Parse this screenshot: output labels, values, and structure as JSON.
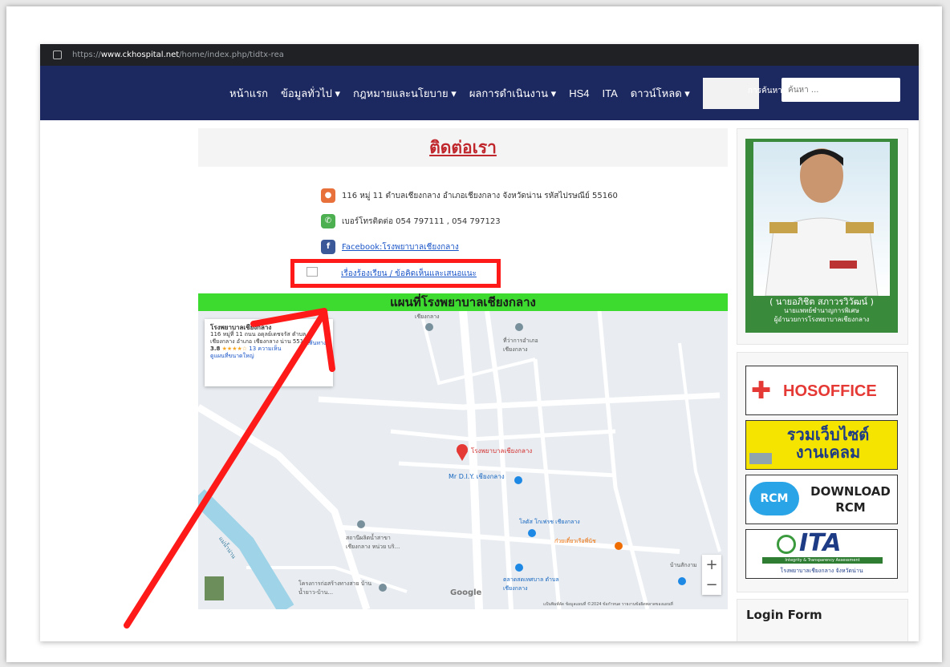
{
  "browser": {
    "url_prefix": "https://",
    "url_domain": "www.ckhospital.net",
    "url_path": "/home/index.php/tidtx-rea"
  },
  "nav": {
    "items": [
      "หน้าแรก",
      "ข้อมูลทั่วไป ▾",
      "กฎหมายและนโยบาย ▾",
      "ผลการดำเนินงาน ▾",
      "HS4",
      "ITA",
      "ดาวน์โหลด ▾"
    ],
    "active": "ติดต่อเรา"
  },
  "search": {
    "label": "การค้นหา",
    "placeholder": "ค้นหา ..."
  },
  "page": {
    "title": "ติดต่อเรา",
    "address": "116 หมู่ 11 ตำบลเชียงกลาง อำเภอเชียงกลาง จังหวัดน่าน รหัสไปรษณีย์ 55160",
    "phone": "เบอร์โทรติดต่อ 054 797111 , 054 797123",
    "facebook": "Facebook:โรงพยาบาลเชียงกลาง",
    "complaint_link": "เรื่องร้องเรียน / ข้อคิดเห็นและเสนอแนะ"
  },
  "map": {
    "header": "แผนที่โรงพยาบาลเชียงกลาง",
    "card": {
      "name": "โรงพยาบาลเชียงกลาง",
      "address": "116 หมู่ที่ 11 ถนน อดุลย์เดชจรัส ตำบล เชียงกลาง อำเภอ เชียงกลาง น่าน 55160",
      "rating": "3.8",
      "stars": "★★★★☆",
      "reviews": "13 ความเห็น",
      "larger_map": "ดูแผนที่ขนาดใหญ่",
      "directions": "เส้นทาง"
    },
    "labels": {
      "hospital": "โรงพยาบาลเชียงกลาง",
      "mr_diy": "Mr D.I.Y. เชียงกลาง",
      "lotus": "โลตัส โกเฟรช เชียงกลาง",
      "district_office": "ที่ว่าการอำเภอเชียงกลาง",
      "electric": "สถานีผลิตน้ำสาขา เชียงกลาง หน่วย บริ...",
      "river": "แม่น้ำน่าน",
      "market": "ตลาดสดเทศบาล ตำบลเชียงกลาง",
      "noodle": "ก๋วยเตี๋ยวเรือพี่นัช",
      "project": "โครงการก่อสร้างทางสาย บ้านน้ำยาว-บ้าน...",
      "village": "บ้านสักงาม",
      "school": "เชียงกลาง",
      "google": "Google",
      "attribution": "แป้นพิมพ์ลัด  ข้อมูลแผนที่ ©2024  ข้อกำหนด  รายงานข้อผิดพลาดของแผนที่"
    },
    "zoom_in": "+",
    "zoom_out": "−"
  },
  "sidebar": {
    "director_name": "( นายอภิชิต สภาวรวิวัฒน์ )",
    "director_pos1": "นายแพทย์ชำนาญการพิเศษ",
    "director_pos2": "ผู้อำนวยการโรงพยาบาลเชียงกลาง",
    "banner_hosoffice": "HOSOFFICE",
    "banner_links_1": "รวมเว็บไซต์",
    "banner_links_2": "งานเคลม",
    "banner_rcm_1": "DOWNLOAD",
    "banner_rcm_2": "RCM",
    "banner_rcm_logo": "RCM",
    "banner_ita": "ITA",
    "banner_ita_sub": "Integrity & Transparency Assessment",
    "banner_ita_caption": "โรงพยาบาลเชียงกลาง จังหวัดน่าน",
    "login_title": "Login Form"
  },
  "colors": {
    "navbar": "#1c2860",
    "title": "#c0272d",
    "map_header": "#3ddb2f",
    "highlight": "#ff1a1a"
  }
}
